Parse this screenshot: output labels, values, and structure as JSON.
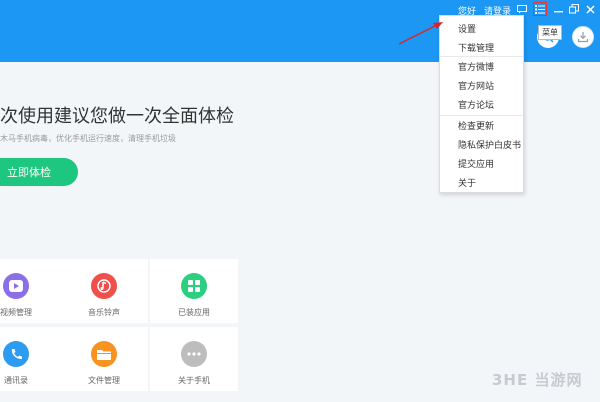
{
  "header": {
    "greeting": "您好",
    "login": "请登录",
    "tooltip": "菜单"
  },
  "icons": {
    "message": "message-icon",
    "menu": "menu-icon",
    "minimize": "minimize-icon",
    "maximize": "maximize-icon",
    "close": "close-icon",
    "search": "search-icon",
    "download": "download-icon"
  },
  "main": {
    "headline": "次使用建议您做一次全面体检",
    "subtext": "木马手机病毒，优化手机运行速度，清理手机垃圾",
    "check_button": "立即体检"
  },
  "tiles": [
    {
      "label": "视频管理",
      "icon": "video-icon",
      "color": "#8a6fe8"
    },
    {
      "label": "音乐铃声",
      "icon": "music-icon",
      "color": "#f04f4a"
    },
    {
      "label": "已装应用",
      "icon": "apps-icon",
      "color": "#2bcf7f"
    },
    {
      "label": "通讯录",
      "icon": "phone-icon",
      "color": "#2d9cf0"
    },
    {
      "label": "文件管理",
      "icon": "folder-icon",
      "color": "#f7931e"
    },
    {
      "label": "关于手机",
      "icon": "more-icon",
      "color": "#bdbdbd"
    }
  ],
  "menu": {
    "items": [
      "设置",
      "下载管理",
      "官方微博",
      "官方网站",
      "官方论坛",
      "检查更新",
      "隐私保护白皮书",
      "提交应用",
      "关于"
    ]
  },
  "watermark": "3HE 当游网"
}
